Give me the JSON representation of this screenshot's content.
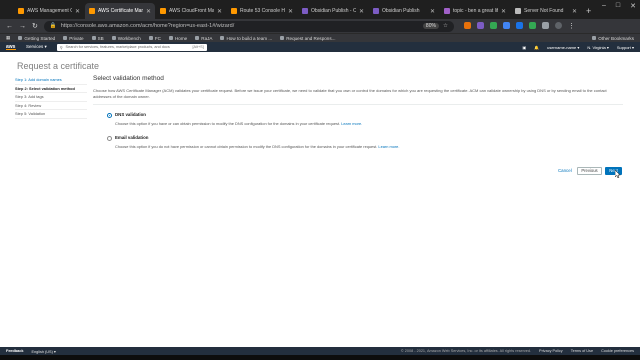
{
  "browser": {
    "tabs": [
      {
        "title": "AWS Management Conso",
        "favicon_color": "#ff9900",
        "active": false
      },
      {
        "title": "AWS Certificate Manage",
        "favicon_color": "#ff9900",
        "active": true
      },
      {
        "title": "AWS CloudFront Manag",
        "favicon_color": "#ff9900",
        "active": false
      },
      {
        "title": "Route 53 Console Hoste",
        "favicon_color": "#ff9900",
        "active": false
      },
      {
        "title": "Obsidian Publish - Obsi",
        "favicon_color": "#7c5cc4",
        "active": false
      },
      {
        "title": "Obsidian Publish",
        "favicon_color": "#7c5cc4",
        "active": false
      },
      {
        "title": "topic - ben a great life",
        "favicon_color": "#a060c8",
        "active": false
      },
      {
        "title": "Server Not Found",
        "favicon_color": "#bbbbbb",
        "active": false
      }
    ],
    "new_tab": "+",
    "url": "https://console.aws.amazon.com/acm/home?region=us-east-1#/wizard/",
    "zoom": "80%",
    "bookmarks": [
      "Getting Started",
      "Private",
      "SB",
      "Workbench",
      "FC",
      "Home",
      "RaJA",
      "How to build a team ...",
      "Request and Respons..."
    ],
    "other_bookmarks": "Other Bookmarks"
  },
  "aws": {
    "logo": "aws",
    "services": "Services ▾",
    "search_placeholder": "Search for services, features, marketplace products, and docs",
    "search_shortcut": "[Alt+S]",
    "account": "username-name ▾",
    "region": "N. Virginia ▾",
    "support": "Support ▾"
  },
  "page": {
    "title": "Request a certificate",
    "steps": [
      {
        "label": "Step 1: Add domain names",
        "state": "link"
      },
      {
        "label": "Step 2: Select validation method",
        "state": "current"
      },
      {
        "label": "Step 3: Add tags",
        "state": "pending"
      },
      {
        "label": "Step 4: Review",
        "state": "pending"
      },
      {
        "label": "Step 5: Validation",
        "state": "pending"
      }
    ],
    "panel_title": "Select validation method",
    "panel_desc": "Choose how AWS Certificate Manager (ACM) validates your certificate request. Before we issue your certificate, we need to validate that you own or control the domains for which you are requesting the certificate. ACM can validate ownership by using DNS or by sending email to the contact addresses of the domain owner.",
    "options": [
      {
        "label": "DNS validation",
        "desc": "Choose this option if you have or can obtain permission to modify the DNS configuration for the domains in your certificate request.",
        "learn": "Learn more.",
        "selected": true
      },
      {
        "label": "Email validation",
        "desc": "Choose this option if you do not have permission or cannot obtain permission to modify the DNS configuration for the domains in your certificate request.",
        "learn": "Learn more.",
        "selected": false
      }
    ],
    "cancel": "Cancel",
    "previous": "Previous",
    "next": "Next"
  },
  "footer": {
    "feedback": "Feedback",
    "language": "English (US) ▾",
    "copyright": "© 2008 - 2021, Amazon Web Services, Inc. or its affiliates. All rights reserved.",
    "privacy": "Privacy Policy",
    "terms": "Terms of Use",
    "cookies": "Cookie preferences"
  },
  "colors": {
    "aws_nav": "#232f3e",
    "accent": "#0073bb",
    "aws_orange": "#ff9900"
  }
}
